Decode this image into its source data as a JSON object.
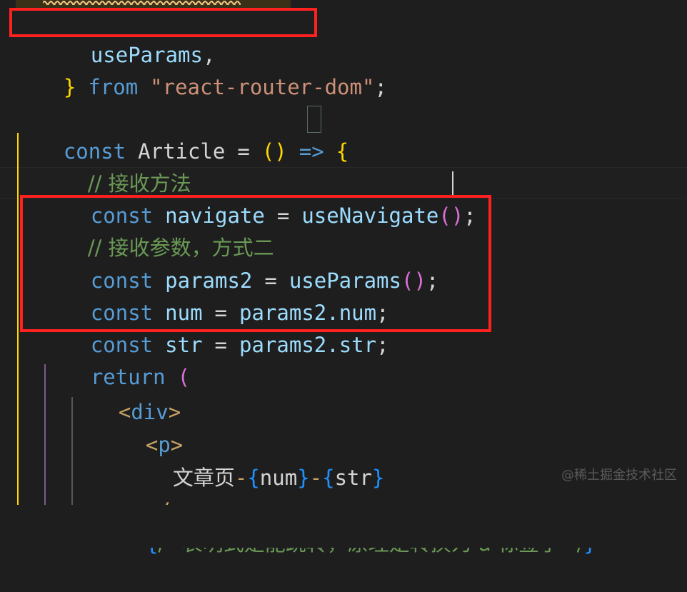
{
  "editor": {
    "theme_name": "vscode-dark-plus",
    "background": "#1e1e1e",
    "foreground": "#d4d4d4",
    "font_size_px": 29,
    "line_height_px": 45,
    "language": "javascriptreact"
  },
  "colors": {
    "keyword": "#569cd6",
    "variable": "#9cdcfe",
    "string": "#ce9178",
    "comment": "#6a9955",
    "bracket_yellow": "#ffd700",
    "bracket_magenta": "#da70d6",
    "bracket_blue": "#179fff",
    "jsx_brace": "#1e90ff",
    "annotation_red": "#ff2020",
    "squiggle_warning": "#e5c07b",
    "indent_guide_active": "#ffd700",
    "indent_guide_magenta": "#7b5a8c",
    "indent_guide_gray": "#575757",
    "watermark": "#5a5a5a"
  },
  "code": {
    "lines": [
      {
        "id": "line-squiggle-partial",
        "text": "",
        "note": "clipped line above viewport; shows a yellow warning squiggle"
      },
      {
        "id": "line-useparams-import",
        "text": "  useParams,"
      },
      {
        "id": "line-import-close",
        "text": "} from \"react-router-dom\";"
      },
      {
        "id": "line-blank-1",
        "text": ""
      },
      {
        "id": "line-const-article",
        "text": "const Article = () => {"
      },
      {
        "id": "line-comment-method",
        "text": "  // 接收方法"
      },
      {
        "id": "line-const-navigate",
        "text": "  const navigate = useNavigate();"
      },
      {
        "id": "line-comment-params",
        "text": "  // 接收参数，方式二"
      },
      {
        "id": "line-const-params2",
        "text": "  const params2 = useParams();"
      },
      {
        "id": "line-const-num",
        "text": "  const num = params2.num;"
      },
      {
        "id": "line-const-str",
        "text": "  const str = params2.str;"
      },
      {
        "id": "line-return-open",
        "text": "  return ("
      },
      {
        "id": "line-div-open",
        "text": "    <div>"
      },
      {
        "id": "line-p-open",
        "text": "      <p>"
      },
      {
        "id": "line-p-content",
        "text": "        文章页-{num}-{str}"
      },
      {
        "id": "line-p-close",
        "text": "      </p>"
      },
      {
        "id": "line-jsx-comment-partial",
        "text": "      {/* 表明式是能跳转，原理是转换为... 标签了 */}"
      }
    ],
    "tokens": {
      "useparams_name": "useParams",
      "comma": ",",
      "close_brace": "}",
      "from_keyword": "from",
      "module_string": "\"react-router-dom\"",
      "semicolon": ";",
      "const_keyword": "const",
      "article_name": "Article",
      "equals": "=",
      "empty_parens": "()",
      "arrow": "=>",
      "open_brace": "{",
      "comment_method": "// 接收方法",
      "navigate_name": "navigate",
      "usenavigate_call": "useNavigate",
      "comment_params": "// 接收参数，方式二",
      "params2_name": "params2",
      "useparams_call": "useParams",
      "num_name": "num",
      "params2_num": "params2.num",
      "str_name": "str",
      "params2_str": "params2.str",
      "return_keyword": "return",
      "open_paren": "(",
      "div_open": "<div>",
      "p_open": "<p>",
      "jsx_text": "文章页",
      "dash": "-",
      "brace_open": "{",
      "brace_close": "}",
      "p_close": "</p>"
    }
  },
  "annotations": [
    {
      "id": "annotation-box-import",
      "label": "red-highlight-useParams-import"
    },
    {
      "id": "annotation-box-params",
      "label": "red-highlight-params-block"
    }
  ],
  "watermark": {
    "text": "@稀土掘金技术社区"
  }
}
